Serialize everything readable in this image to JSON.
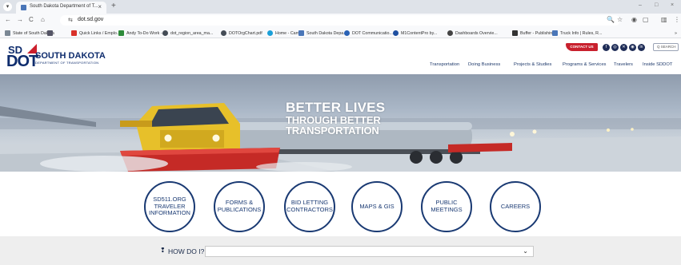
{
  "browser": {
    "tab_title": "South Dakota Department of T...",
    "tab_close": "×",
    "new_tab": "+",
    "tab_menu": "▾",
    "window_controls": [
      "–",
      "□",
      "×"
    ],
    "url": "dot.sd.gov",
    "nav": [
      "←",
      "→",
      "C",
      "⌂",
      "⇆"
    ],
    "address_icons": [
      "🔍",
      "☆",
      "◉",
      "▢",
      "▥",
      "⋮"
    ],
    "bookmarks": [
      {
        "label": "State of South Dakota",
        "icon_color": "#7a8794"
      },
      {
        "label": "",
        "icon_color": "#556"
      },
      {
        "label": "Quick Links / Emplo...",
        "icon_color": "#d9312a"
      },
      {
        "label": "Andy To-Do Work -...",
        "icon_color": "#2e8b3a"
      },
      {
        "label": "dot_region_area_ma...",
        "icon_color": "#444c56"
      },
      {
        "label": "DOTOrgChart.pdf",
        "icon_color": "#444c56"
      },
      {
        "label": "Home - Canva",
        "icon_color": "#1a9fd8"
      },
      {
        "label": "South Dakota Depa...",
        "icon_color": "#4a76b8"
      },
      {
        "label": "DOT Communicatio...",
        "icon_color": "#2a62b5"
      },
      {
        "label": "M1ContentPro by...",
        "icon_color": "#1e4fa0"
      },
      {
        "label": "Dashboards Overvie...",
        "icon_color": "#444"
      },
      {
        "label": "Buffer - Publishing",
        "icon_color": "#333"
      },
      {
        "label": "Truck Info | Rules, R...",
        "icon_color": "#4a76b8"
      },
      {
        "label": "»",
        "icon_color": ""
      }
    ]
  },
  "site": {
    "logo_sd": "SD",
    "logo_dot": "DOT",
    "logo_name": "SOUTH DAKOTA",
    "logo_sub": "DEPARTMENT OF TRANSPORTATION",
    "contact": "CONTACT US",
    "social": [
      "f",
      "◎",
      "✕",
      "◉",
      "in"
    ],
    "search": "Q SEARCH",
    "nav": [
      "Transportation",
      "Doing Business",
      "Projects & Studies",
      "Programs & Services",
      "Travelers",
      "Inside SDDOT"
    ],
    "hero_line1": "BETTER LIVES",
    "hero_line2": "THROUGH BETTER",
    "hero_line3": "TRANSPORTATION",
    "quick_links": [
      "SD511.ORG\nTRAVELER\nINFORMATION",
      "FORMS &\nPUBLICATIONS",
      "BID LETTING\nCONTRACTORS",
      "MAPS & GIS",
      "PUBLIC\nMEETINGS",
      "CAREERS"
    ],
    "how_do_i": "HOW DO I?",
    "how_icon": "❢",
    "how_chevron": "⌄"
  }
}
